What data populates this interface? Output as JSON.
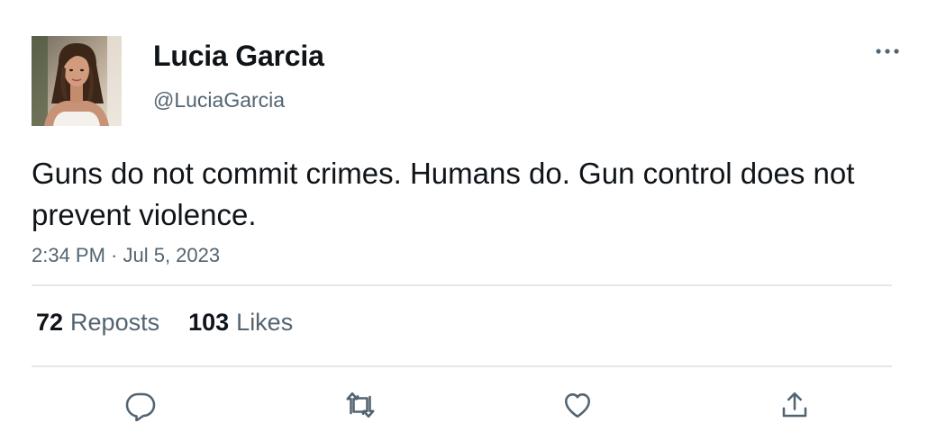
{
  "user": {
    "display_name": "Lucia Garcia",
    "handle": "@LuciaGarcia"
  },
  "tweet": {
    "text": "Guns do not commit crimes. Humans do. Gun control does not prevent violence.",
    "timestamp": "2:34 PM · Jul 5, 2023"
  },
  "stats": {
    "reposts_count": "72",
    "reposts_label": "Reposts",
    "likes_count": "103",
    "likes_label": "Likes"
  },
  "icons": {
    "more": "more-horizontal-icon",
    "reply": "reply-icon",
    "repost": "repost-icon",
    "like": "heart-icon",
    "share": "share-icon"
  },
  "colors": {
    "text_primary": "#0f1419",
    "text_secondary": "#536471",
    "divider": "#e3e7ea"
  }
}
